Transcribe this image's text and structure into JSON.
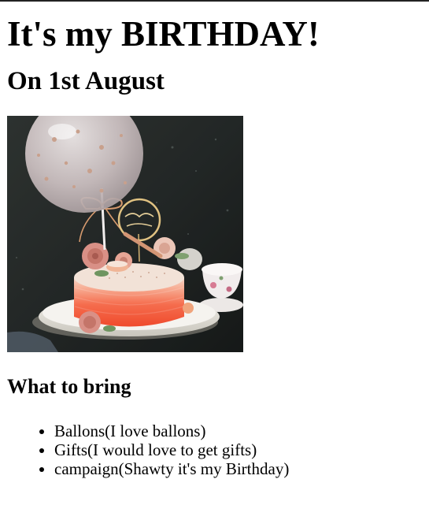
{
  "page": {
    "title": "It's my BIRTHDAY!",
    "subtitle": "On 1st August"
  },
  "image": {
    "alt": "Birthday cake"
  },
  "bring": {
    "heading": "What to bring",
    "items": [
      {
        "label": "Ballons(I love ballons)"
      },
      {
        "label": "Gifts(I would love to get gifts)"
      },
      {
        "label": "campaign(Shawty it's my Birthday)"
      }
    ]
  }
}
